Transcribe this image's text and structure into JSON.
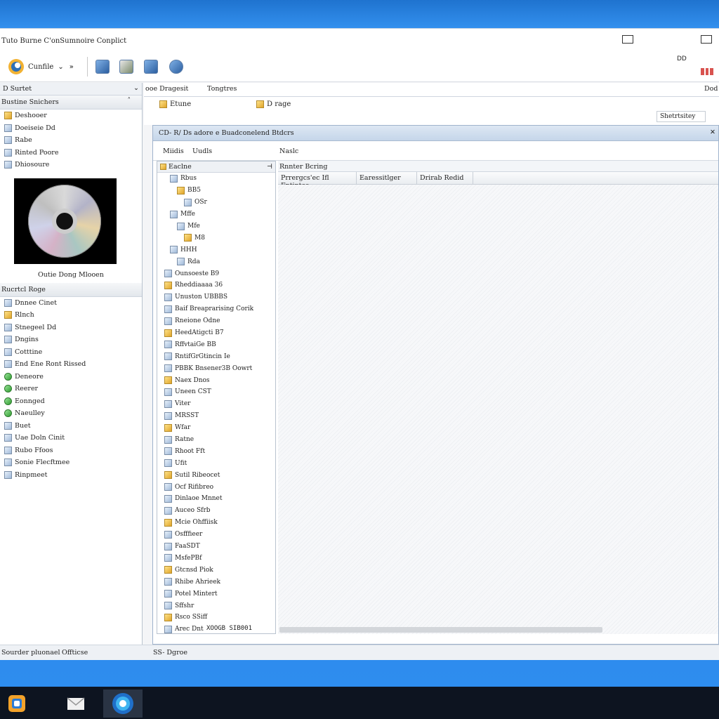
{
  "window": {
    "title": "Tuto Burne C'onSumnoire Conplict"
  },
  "toolbar": {
    "app_label": "Cunfile",
    "right_text": "DD"
  },
  "left": {
    "header": "D Surtet",
    "section1": "Bustine Snichers",
    "items1": [
      {
        "label": "Deshooer",
        "icon": "folder-icon"
      },
      {
        "label": "Doeiseie Dd",
        "icon": "drive-icon"
      },
      {
        "label": "Rabe",
        "icon": "file-icon"
      },
      {
        "label": "Rinted Poore",
        "icon": "file-icon"
      },
      {
        "label": "Dhiosoure",
        "icon": "drive-icon"
      }
    ],
    "disc_caption": "Outie Dong Mlooen",
    "section2": "Rucrtcl Roge",
    "items2": [
      {
        "label": "Dnnee Cinet",
        "icon": "drive-icon"
      },
      {
        "label": "Rlnch",
        "icon": "folder-icon"
      },
      {
        "label": "Stnegeel Dd",
        "icon": "drive-icon"
      },
      {
        "label": "Dngins",
        "icon": "drive-icon"
      },
      {
        "label": "Cotttine",
        "icon": "drive-icon"
      },
      {
        "label": "End Ene Ront Rissed",
        "icon": "file-icon"
      },
      {
        "label": "Deneore",
        "icon": "globe-icon"
      },
      {
        "label": "Reerer",
        "icon": "globe-icon"
      },
      {
        "label": "Eonnged",
        "icon": "globe-icon"
      },
      {
        "label": "Naeulley",
        "icon": "globe-icon"
      },
      {
        "label": "Buet",
        "icon": "drive-icon"
      },
      {
        "label": "Uae Doln Cinit",
        "icon": "file-icon"
      },
      {
        "label": "Rubo Ffoos",
        "icon": "file-icon"
      },
      {
        "label": "Sonie Flecftmee",
        "icon": "file-icon"
      },
      {
        "label": "Rinpmeet",
        "icon": "file-icon"
      }
    ]
  },
  "right_top": {
    "left_label": "ooe Dragesit",
    "right_label": "Tongtres",
    "far_right": "Dod"
  },
  "right_toolbar": {
    "item1": "Etune",
    "item2": "D rage",
    "search_placeholder": "Shetrtsitey"
  },
  "inner": {
    "title": "CD- R/ Ds adore e Buadconelend Btdcrs",
    "col_a": "Miidis",
    "col_b": "Uudls",
    "col_c": "Naslc",
    "tree_header": "Eaclne",
    "tree_items": [
      "Rbus",
      "BB5",
      "OSr",
      "Mffe",
      "Mfe",
      "M8",
      "HHH",
      "Rda",
      "Ounsoeste B9",
      "Rheddiaaaa 36",
      "Unuston UBBBS",
      "Baif Breaprarising Corik",
      "Rneione Odne",
      "HeedAtigcti B7",
      "RffvtaiGe BB",
      "RntifGrGtincin Ie",
      "PBBK Bnsener3B Oowrt",
      "Naex Dnos",
      "Uneen CST",
      "Viter",
      "MRSST",
      "Wfar",
      "Ratne",
      "Rhoot Fft",
      "Ufit",
      "Sutil Ribeocet",
      "Ocf Rifibreo",
      "Dinlaoe Mnnet",
      "Auceo Sfrb",
      "Mcie Ohffiisk",
      "Osfffieer",
      "FaaSDT",
      "MsfePBf",
      "Gtcnsd Piok",
      "Rhibe Ahrieek",
      "Potel Mintert",
      "Sffshr",
      "Rsco SSiff",
      "Arec Dnt"
    ],
    "tree_scroll_value": "XOOGB SIB001",
    "list_caption": "Rnnter Bcring",
    "columns": [
      "Prrergcs'ec Ifl  Fntintes",
      "Earessitlger",
      "Drirab Redid"
    ]
  },
  "statusbar": {
    "left": "Sourder pluonael",
    "mid": "Offticse",
    "right": "SS- Dgroe"
  },
  "taskbar": {
    "apps": [
      "office-app-icon",
      "mail-app-icon",
      "browser-app-icon"
    ]
  },
  "colors": {
    "desktop": "#2f8ef0",
    "taskbar": "#0d1420",
    "accent": "#2c5fa0"
  }
}
